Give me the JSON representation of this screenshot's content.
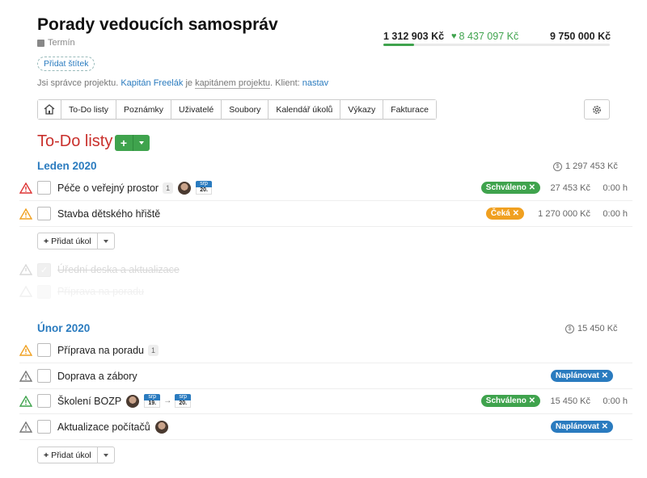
{
  "project": {
    "title": "Porady vedoucích samospráv",
    "deadline_label": "Termín",
    "add_tag_label": "Přidat štítek",
    "admin": {
      "prefix": "Jsi správce projektu.",
      "manager": "Kapitán Freelák",
      "middle": "je",
      "role": "kapitánem projektu",
      "client_prefix": ". Klient:",
      "client": "nastav"
    }
  },
  "budget": {
    "spent": "1 312 903 Kč",
    "profit": "8 437 097 Kč",
    "total": "9 750 000 Kč",
    "progress": 0.135,
    "accent": "#3fa34d"
  },
  "tabs": [
    "Poznámky",
    "Uživatelé",
    "Soubory",
    "Kalendář úkolů",
    "Výkazy",
    "Fakturace"
  ],
  "tab_todo": "To-Do listy",
  "section_title": "To-Do listy",
  "lists": [
    {
      "name": "Leden 2020",
      "total": "1 297 453 Kč",
      "tasks": [
        {
          "name": "Péče o veřejný prostor",
          "count": "1",
          "priority": "red",
          "date_month": "srp",
          "date_day": "20.",
          "status": "Schváleno",
          "amount": "27 453 Kč",
          "time": "0:00 h"
        },
        {
          "name": "Stavba dětského hřiště",
          "priority": "orange",
          "status": "Čeká",
          "amount": "1 270 000 Kč",
          "time": "0:00 h"
        }
      ],
      "completed": [
        {
          "name": "Úřední deska a aktualizace"
        },
        {
          "name": "Příprava na poradu"
        }
      ],
      "add_task": "Přidat úkol"
    },
    {
      "name": "Únor 2020",
      "total": "15 450 Kč",
      "tasks": [
        {
          "name": "Příprava na poradu",
          "count": "1",
          "priority": "orange"
        },
        {
          "name": "Doprava a zábory",
          "priority": "gray",
          "status": "Naplánovat"
        },
        {
          "name": "Školení BOZP",
          "priority": "green",
          "from_month": "srp",
          "from_day": "19.",
          "to_month": "srp",
          "to_day": "20.",
          "status": "Schváleno",
          "amount": "15 450 Kč",
          "time": "0:00 h"
        },
        {
          "name": "Aktualizace počítačů",
          "priority": "gray",
          "status": "Naplánovat"
        }
      ],
      "add_task": "Přidat úkol"
    }
  ]
}
